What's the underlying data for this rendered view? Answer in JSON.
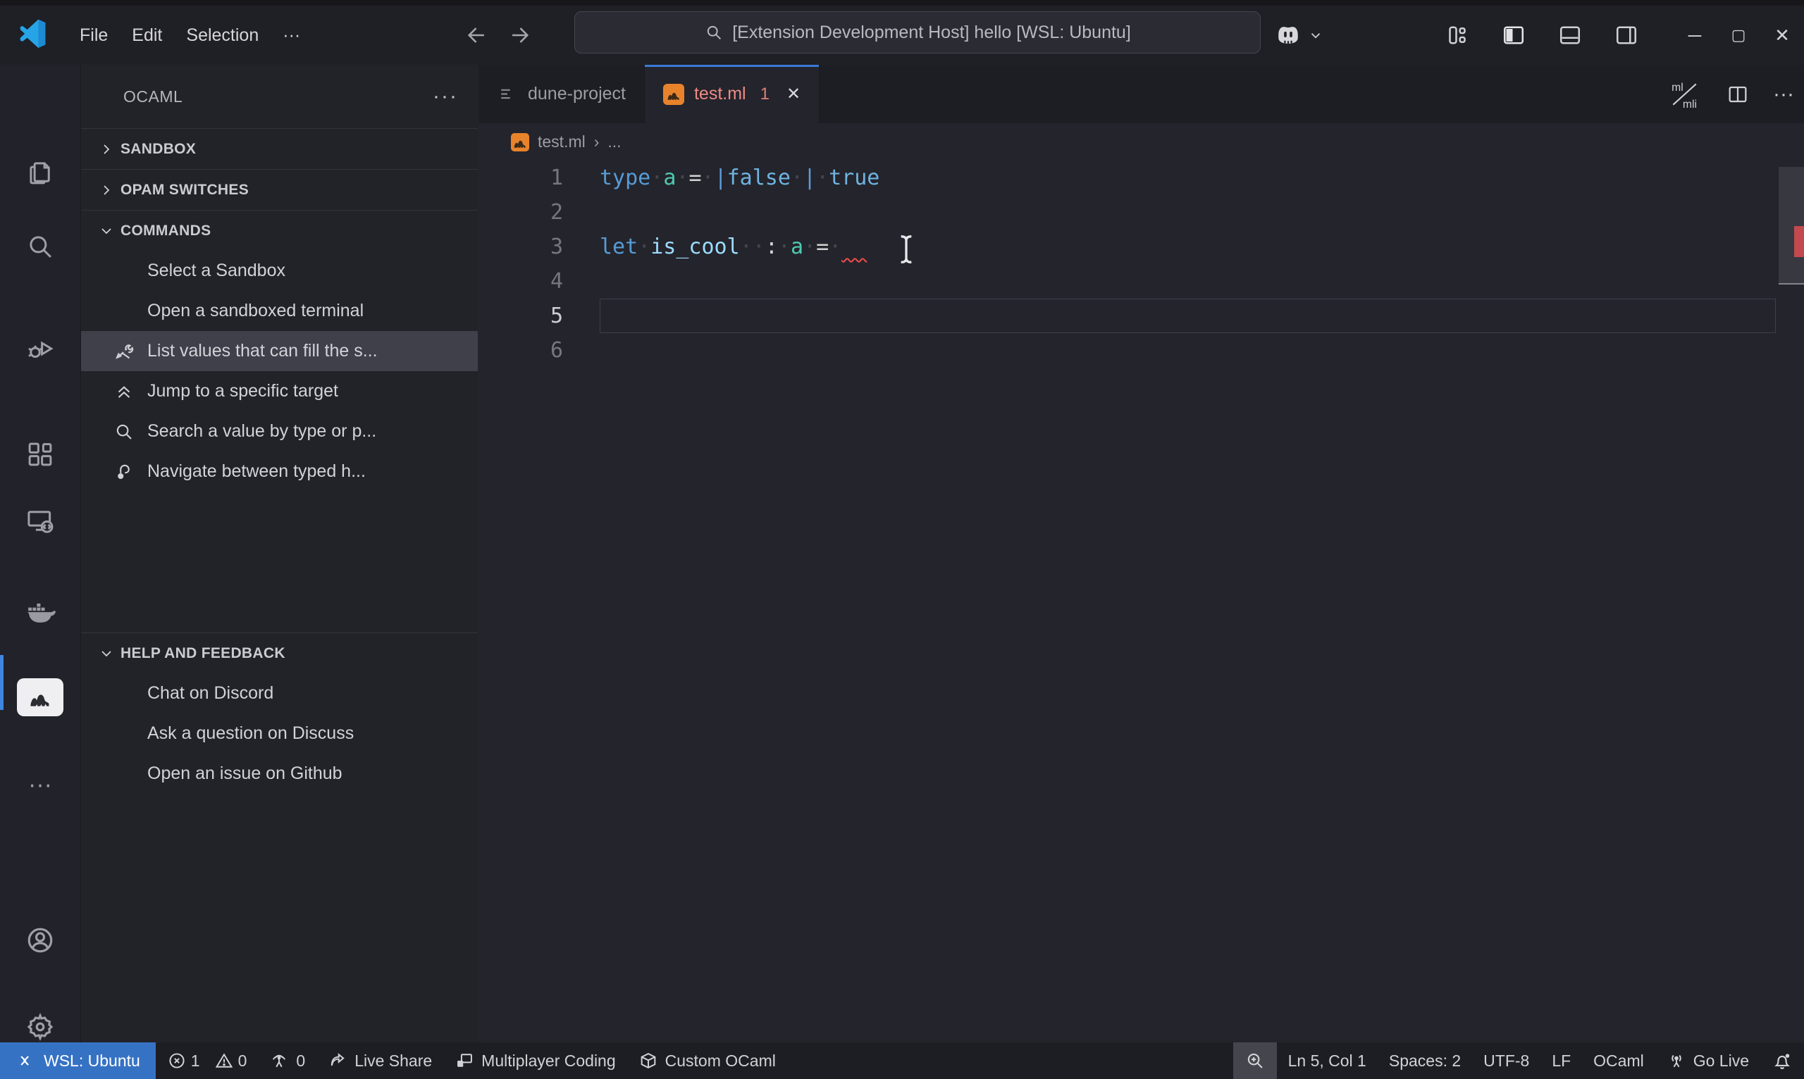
{
  "theme": {
    "accent_blue": "#3672c4",
    "tab_active_border": "#3a7bd5",
    "error_red": "#f14c4c",
    "camel_orange": "#e8832c",
    "selection_bg": "#40404b"
  },
  "titlebar": {
    "menus": [
      "File",
      "Edit",
      "Selection",
      "···"
    ],
    "search_value": "[Extension Development Host] hello [WSL: Ubuntu]",
    "window_buttons": [
      "minimize",
      "maximize",
      "close"
    ]
  },
  "activity_bar": {
    "top": [
      {
        "name": "explorer"
      },
      {
        "name": "search"
      },
      {
        "name": "run-and-debug"
      },
      {
        "name": "extensions"
      },
      {
        "name": "remote-explorer"
      },
      {
        "name": "docker"
      },
      {
        "name": "ocaml",
        "active": true
      },
      {
        "name": "more-views",
        "glyph": "···"
      }
    ],
    "bottom": [
      {
        "name": "accounts"
      },
      {
        "name": "settings"
      }
    ]
  },
  "sidebar": {
    "title": "OCAML",
    "more_label": "···",
    "sections": [
      {
        "label": "SANDBOX",
        "collapsed": true,
        "items": []
      },
      {
        "label": "OPAM SWITCHES",
        "collapsed": true,
        "items": []
      },
      {
        "label": "COMMANDS",
        "collapsed": false,
        "items": [
          {
            "label": "Select a Sandbox",
            "icon": ""
          },
          {
            "label": "Open a sandboxed terminal",
            "icon": ""
          },
          {
            "label": "List values that can fill the s...",
            "icon": "tools",
            "selected": true
          },
          {
            "label": "Jump to a specific target",
            "icon": "double-chevron-up"
          },
          {
            "label": "Search a value by type or p...",
            "icon": "search-small"
          },
          {
            "label": "Navigate between typed h...",
            "icon": "hook"
          }
        ]
      },
      {
        "label": "HELP AND FEEDBACK",
        "collapsed": false,
        "gap_before": true,
        "items": [
          {
            "label": "Chat on Discord",
            "icon": ""
          },
          {
            "label": "Ask a question on Discuss",
            "icon": ""
          },
          {
            "label": "Open an issue on Github",
            "icon": ""
          }
        ]
      }
    ]
  },
  "editor": {
    "tabs": [
      {
        "name": "dune-project",
        "icon": "list-lines",
        "active": false
      },
      {
        "name": "test.ml",
        "icon": "camel",
        "active": true,
        "badge": "1",
        "close": "✕",
        "name_color": "#ef8a85",
        "badge_color": "#e07e79"
      }
    ],
    "actions": [
      {
        "name": "ml-mli-switch",
        "labels": [
          "ml",
          "mli"
        ]
      },
      {
        "name": "split-editor"
      },
      {
        "name": "more-actions",
        "glyph": "···"
      }
    ],
    "breadcrumb": {
      "file": "test.ml",
      "separator": "›",
      "rest": "..."
    },
    "lines": [
      {
        "num": "1",
        "tokens": [
          {
            "t": "type",
            "c": "kw"
          },
          {
            "t": "·",
            "c": "ws"
          },
          {
            "t": "a",
            "c": "type"
          },
          {
            "t": "·",
            "c": "ws"
          },
          {
            "t": "=",
            "c": "op"
          },
          {
            "t": "·",
            "c": "ws"
          },
          {
            "t": "|",
            "c": "pipe"
          },
          {
            "t": "false",
            "c": "lit"
          },
          {
            "t": "·",
            "c": "ws"
          },
          {
            "t": "|",
            "c": "pipe"
          },
          {
            "t": "·",
            "c": "ws"
          },
          {
            "t": "true",
            "c": "lit"
          }
        ]
      },
      {
        "num": "2",
        "tokens": []
      },
      {
        "num": "3",
        "tokens": [
          {
            "t": "let",
            "c": "kw"
          },
          {
            "t": "·",
            "c": "ws"
          },
          {
            "t": "is_cool",
            "c": "ident"
          },
          {
            "t": "··",
            "c": "ws"
          },
          {
            "t": ":",
            "c": "op"
          },
          {
            "t": "·",
            "c": "ws"
          },
          {
            "t": "a",
            "c": "type"
          },
          {
            "t": "·",
            "c": "ws"
          },
          {
            "t": "=",
            "c": "op"
          },
          {
            "t": "·",
            "c": "ws"
          },
          {
            "t": "  ",
            "c": "sq"
          }
        ]
      },
      {
        "num": "4",
        "tokens": []
      },
      {
        "num": "5",
        "tokens": [],
        "current": true
      },
      {
        "num": "6",
        "tokens": []
      }
    ]
  },
  "status_bar": {
    "left": [
      {
        "name": "remote",
        "icon": "remote-angles",
        "label": "WSL: Ubuntu",
        "remote": true
      },
      {
        "name": "problems",
        "parts": [
          {
            "icon": "error-circle",
            "label": "1"
          },
          {
            "icon": "warning-triangle",
            "label": "0"
          }
        ]
      },
      {
        "name": "ports",
        "icon": "radio-tower",
        "label": "0"
      },
      {
        "name": "live-share",
        "icon": "share-arrow",
        "label": "Live Share"
      },
      {
        "name": "multiplayer-coding",
        "icon": "windows-overlap",
        "label": "Multiplayer Coding"
      },
      {
        "name": "custom-ocaml",
        "icon": "package-cube",
        "label": "Custom OCaml"
      }
    ],
    "right": [
      {
        "name": "screencast-zoom",
        "icon": "magnifier-plus",
        "label": "",
        "highlight": true
      },
      {
        "name": "cursor-position",
        "label": "Ln 5, Col 1"
      },
      {
        "name": "indentation",
        "label": "Spaces: 2"
      },
      {
        "name": "encoding",
        "label": "UTF-8"
      },
      {
        "name": "eol",
        "label": "LF"
      },
      {
        "name": "language-mode",
        "label": "OCaml"
      },
      {
        "name": "go-live",
        "icon": "broadcast-antenna",
        "label": "Go Live"
      },
      {
        "name": "notifications",
        "icon": "bell",
        "label": ""
      }
    ]
  }
}
